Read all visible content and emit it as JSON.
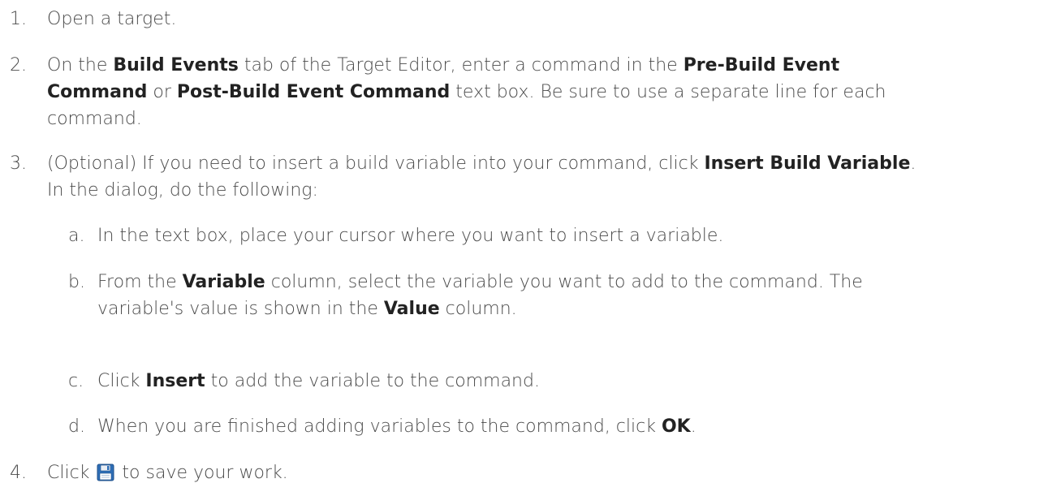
{
  "steps": [
    {
      "num": "1.",
      "text": "Open a target."
    },
    {
      "num": "2.",
      "p1": "On the ",
      "b1": "Build Events",
      "p2": " tab of the Target Editor, enter a command in the ",
      "b2": "Pre-Build Event",
      "p3": "",
      "b3": "Command",
      "p4": " or ",
      "b4": "Post-Build Event Command",
      "p5": " text box. Be sure to use a separate line for each",
      "p6": "command."
    },
    {
      "num": "3.",
      "p1": "(Optional) If you need to insert a build variable into your command, click ",
      "b1": "Insert Build Variable",
      "p2": ".",
      "p3": "In the dialog, do the following:",
      "substeps": [
        {
          "num": "a.",
          "text": "In the text box, place your cursor where you want to insert a variable."
        },
        {
          "num": "b.",
          "p1": "From the ",
          "b1": "Variable",
          "p2": " column, select the variable you want to add to the command. The",
          "p3": "variable's value is shown in the ",
          "b2": "Value",
          "p4": " column."
        },
        {
          "num": "c.",
          "p1": "Click ",
          "b1": "Insert",
          "p2": " to add the variable to the command."
        },
        {
          "num": "d.",
          "p1": "When you are finished adding variables to the command, click ",
          "b1": "OK",
          "p2": "."
        }
      ]
    },
    {
      "num": "4.",
      "p1": "Click ",
      "icon": "save-icon",
      "p2": " to save your work."
    }
  ]
}
